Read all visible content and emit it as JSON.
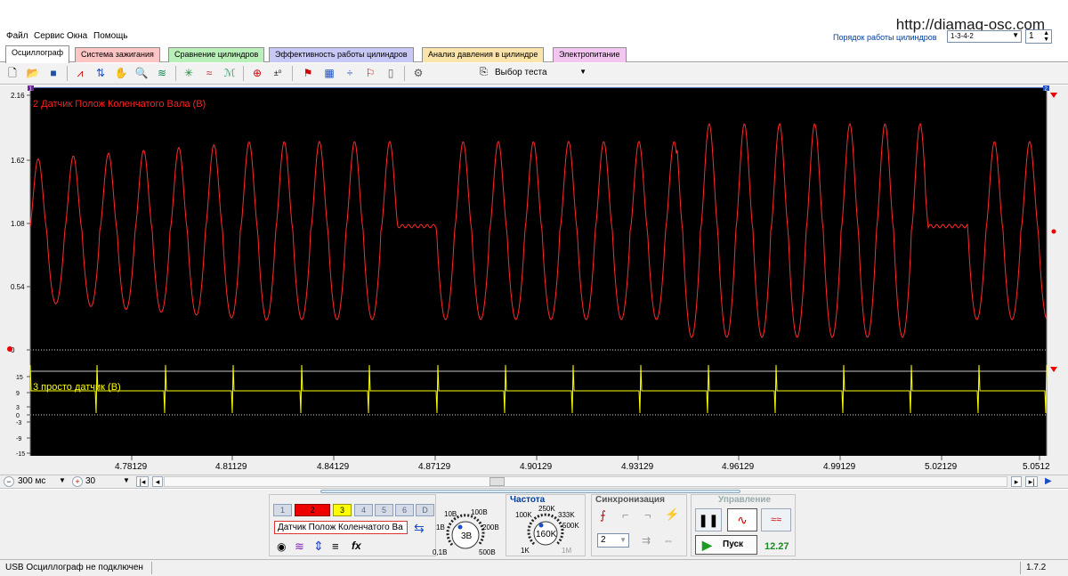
{
  "menu": {
    "items": [
      "Файл",
      "Сервис",
      "Окна",
      "Помощь"
    ],
    "watermark": "http://diamag-osc.com",
    "cylinder_order_label": "Порядок работы цилиндров",
    "cylinder_order_value": "1-3-4-2",
    "cylinder_value": "1"
  },
  "tabs": [
    {
      "label": "Осциллограф",
      "color": "#ffffff"
    },
    {
      "label": "Система зажигания",
      "color": "#ffc0c0"
    },
    {
      "label": "Сравнение цилиндров",
      "color": "#b7f0b7"
    },
    {
      "label": "Эффективность работы цилиндров",
      "color": "#c4c4f6"
    },
    {
      "label": "Анализ давления в цилиндре",
      "color": "#fbe3a7"
    },
    {
      "label": "Электропитание",
      "color": "#f1c4f0"
    }
  ],
  "toolbar": {
    "icons": [
      "new-file-icon",
      "open-folder-icon",
      "save-icon",
      "fft-icon",
      "cursor-icon",
      "hand-pan-icon",
      "zoom-icon",
      "filter-icon",
      "spark-icon",
      "overlay-icon",
      "compare-icon",
      "auto-icon",
      "zero-icon",
      "marker-icon",
      "grid-icon",
      "split-icon",
      "flag-icon",
      "note-icon",
      "auto-mode-icon"
    ],
    "test_select_label": "Выбор теста"
  },
  "plot": {
    "channel2_label": "2 Датчик Полож Коленчатого Вала (В)",
    "channel3_label": "3 просто датчик (В)",
    "channel2_color": "#ff2020",
    "channel3_color": "#ffff00",
    "background": "#000000",
    "y_ticks_ch2": [
      "2.16",
      "1.62",
      "1.08",
      "0.54",
      "0"
    ],
    "y_ticks_ch3": [
      "15",
      "9",
      "3",
      "0",
      "-3",
      "-9",
      "-15"
    ],
    "x_ticks": [
      "4.78129",
      "4.81129",
      "4.84129",
      "4.87129",
      "4.90129",
      "4.93129",
      "4.96129",
      "4.99129",
      "5.02129",
      "5.0512"
    ],
    "corner_markers": [
      "1",
      "2"
    ]
  },
  "timebar": {
    "time_per_div": "300 мс",
    "zoom_value": "30"
  },
  "channels": {
    "buttons": [
      "1",
      "2",
      "3",
      "4",
      "5",
      "6",
      "D"
    ],
    "active": "2",
    "sensor_name": "Датчик Полож Коленчатого Ва"
  },
  "voltage_knob": {
    "labels": [
      "10В",
      "100В",
      "1В",
      "200В",
      "0,1В",
      "500В"
    ],
    "value": "3В"
  },
  "frequency": {
    "title": "Частота",
    "labels": [
      "250K",
      "100K",
      "333K",
      "500K",
      "1K",
      "1M"
    ],
    "value": "160K"
  },
  "sync": {
    "title": "Синхронизация",
    "channel_value": "2"
  },
  "control": {
    "title": "Управление",
    "start_label": "Пуск",
    "fps_value": "12.27"
  },
  "status": {
    "text": "USB Осциллограф не подключен",
    "version": "1.7.2"
  }
}
